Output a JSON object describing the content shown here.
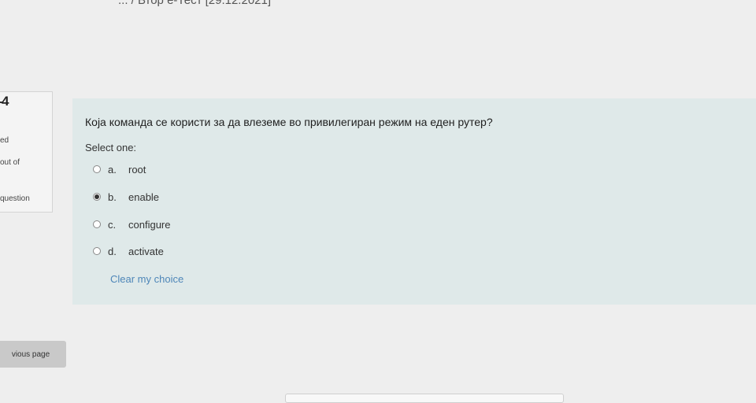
{
  "breadcrumb": {
    "text": "... / Втор е-Тест [29.12.2021]"
  },
  "question_info": {
    "number": "4",
    "status": "ed",
    "marks": "out of",
    "flag": "question"
  },
  "question": {
    "text": "Која команда се користи за да влеземе во привилегиран режим на еден рутер?",
    "prompt": "Select one:",
    "options": [
      {
        "letter": "a.",
        "label": "root",
        "selected": false
      },
      {
        "letter": "b.",
        "label": "enable",
        "selected": true
      },
      {
        "letter": "c.",
        "label": "configure",
        "selected": false
      },
      {
        "letter": "d.",
        "label": "activate",
        "selected": false
      }
    ],
    "clear_label": "Clear my choice"
  },
  "navigation": {
    "previous_label": "vious page"
  },
  "colors": {
    "question_bg": "#dfe9e9",
    "link": "#4e86b8",
    "info_bg": "#f4f4f4"
  }
}
